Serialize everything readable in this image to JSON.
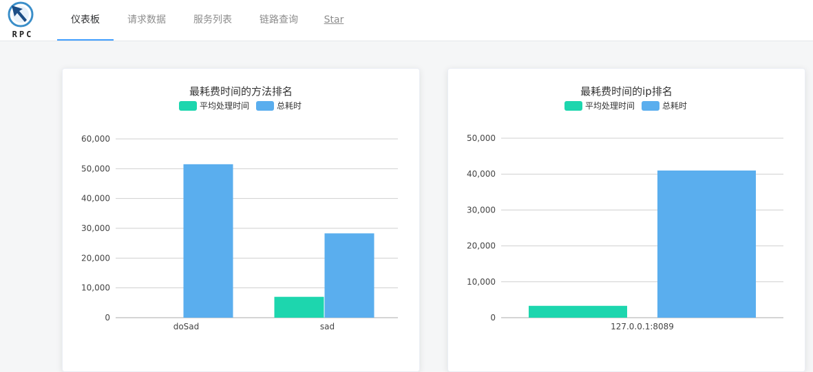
{
  "logo": {
    "text": "RPC"
  },
  "nav": {
    "tabs": [
      {
        "label": "仪表板",
        "active": true
      },
      {
        "label": "请求数据",
        "active": false
      },
      {
        "label": "服务列表",
        "active": false
      },
      {
        "label": "链路查询",
        "active": false
      },
      {
        "label": "Star",
        "active": false
      }
    ]
  },
  "colors": {
    "avg": "#1dd6ae",
    "total": "#5aaeee",
    "accent": "#409eff"
  },
  "chart_data": [
    {
      "type": "bar",
      "title": "最耗费时间的方法排名",
      "legend": [
        "平均处理时间",
        "总耗时"
      ],
      "categories": [
        "doSad",
        "sad"
      ],
      "series": [
        {
          "name": "平均处理时间",
          "values": [
            0,
            7000
          ]
        },
        {
          "name": "总耗时",
          "values": [
            51500,
            28300
          ]
        }
      ],
      "y_ticks": [
        "0",
        "10,000",
        "20,000",
        "30,000",
        "40,000",
        "50,000",
        "60,000"
      ],
      "ylim": [
        0,
        60000
      ],
      "grid": true,
      "legend_position": "top-center"
    },
    {
      "type": "bar",
      "title": "最耗费时间的ip排名",
      "legend": [
        "平均处理时间",
        "总耗时"
      ],
      "categories": [
        "127.0.0.1:8089"
      ],
      "series": [
        {
          "name": "平均处理时间",
          "values": [
            3300
          ]
        },
        {
          "name": "总耗时",
          "values": [
            41000
          ]
        }
      ],
      "y_ticks": [
        "0",
        "10,000",
        "20,000",
        "30,000",
        "40,000",
        "50,000"
      ],
      "ylim": [
        0,
        50000
      ],
      "grid": true,
      "legend_position": "top-center"
    }
  ]
}
